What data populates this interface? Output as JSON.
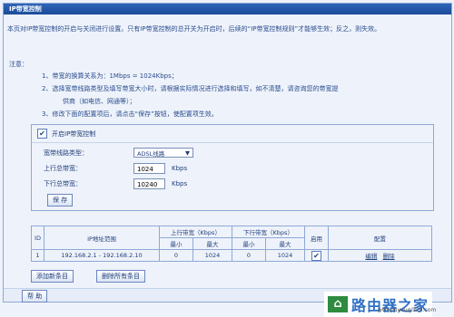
{
  "window": {
    "title": "IP带宽控制"
  },
  "intro": "本页对IP带宽控制的开启与关闭进行设置。只有IP带宽控制的总开关为开启时，后续的“IP带宽控制规则”才能够生效；反之，则失效。",
  "notes": {
    "title": "注意：",
    "items": [
      "1、带宽的换算关系为：1Mbps = 1024Kbps；",
      "2、选择宽带线路类型及填写带宽大小时，请根据实际情况进行选择和填写，如不清楚，请咨询您的带宽提",
      "供商（如电信、网通等）；",
      "3、修改下面的配置项后，请点击“保存”按钮，使配置项生效。"
    ]
  },
  "settings": {
    "enable_label": "开启IP带宽控制",
    "enabled_check": "✔",
    "line_type_label": "宽带线路类型：",
    "line_type_value": "ADSL线路",
    "upstream_label": "上行总带宽：",
    "upstream_value": "1024",
    "downstream_label": "下行总带宽：",
    "downstream_value": "10240",
    "unit": "Kbps",
    "save_button": "保 存"
  },
  "table": {
    "headers": {
      "id": "ID",
      "ip_range": "IP地址范围",
      "up": "上行带宽（Kbps）",
      "down": "下行带宽（Kbps）",
      "enable": "启用",
      "config": "配置",
      "min": "最小",
      "max": "最大"
    },
    "rows": [
      {
        "id": "1",
        "ip_range": "192.168.2.1 - 192.168.2.10",
        "up_min": "0",
        "up_max": "1024",
        "down_min": "0",
        "down_max": "1024",
        "enabled": "✔",
        "edit": "编辑",
        "delete": "删除"
      }
    ]
  },
  "buttons": {
    "add": "添加新条目",
    "delete_all": "删除所有条目",
    "help": "帮 助"
  },
  "watermark": {
    "text": "路由器之家",
    "url": "www.luyouqi520.com"
  }
}
